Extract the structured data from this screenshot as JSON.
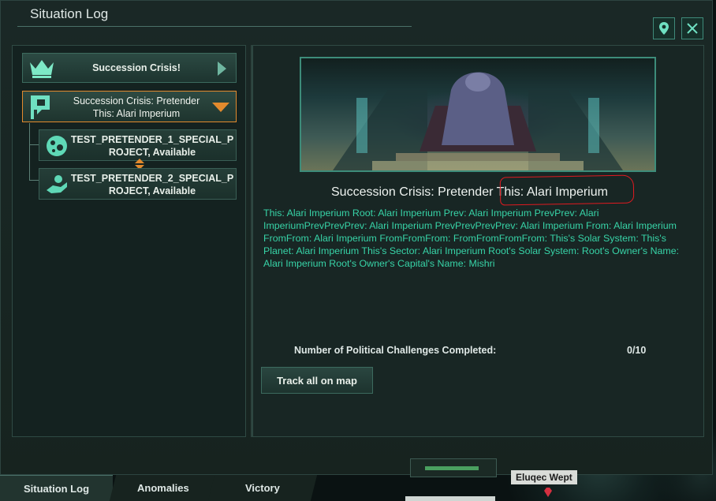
{
  "window": {
    "title": "Situation Log"
  },
  "list": {
    "header_label": "Succession Crisis!",
    "selected_item": {
      "line1": "Succession Crisis: Pretender",
      "line2": "This: Alari Imperium"
    },
    "projects": [
      {
        "line1": "TEST_PRETENDER_1_SPECIAL_P",
        "line2": "ROJECT, Available"
      },
      {
        "line1": "TEST_PRETENDER_2_SPECIAL_P",
        "line2": "ROJECT, Available"
      }
    ]
  },
  "detail": {
    "title_prefix": "Succession Crisis: Pretender ",
    "title_highlight": "This: Alari Imperium",
    "description": "This: Alari Imperium Root: Alari Imperium Prev: Alari Imperium PrevPrev: Alari ImperiumPrevPrevPrev: Alari Imperium PrevPrevPrevPrev: Alari Imperium From: Alari Imperium FromFrom: Alari Imperium FromFromFrom:  FromFromFromFrom:  This's Solar System:  This's Planet: Alari Imperium This's Sector: Alari Imperium Root's Solar System:  Root's Owner's Name: Alari Imperium Root's Owner's Capital's Name: Mishri",
    "challenges_label": "Number of Political Challenges Completed:",
    "challenges_value": "0/10",
    "track_button": "Track all on map"
  },
  "tabs": [
    "Situation Log",
    "Anomalies",
    "Victory"
  ],
  "map": {
    "planet_label": "Eluqec Wept"
  },
  "colors": {
    "accent": "#3d8c7a",
    "selected_border": "#e38a2d",
    "description_text": "#37d3a7",
    "annotation": "#e01a20"
  }
}
